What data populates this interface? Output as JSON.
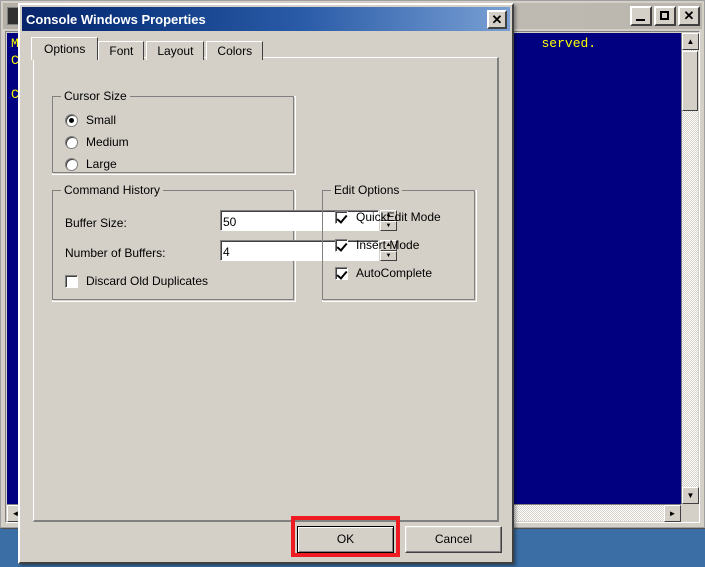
{
  "desktop": {
    "background_color": "#3a6ea5"
  },
  "console_window": {
    "title": "",
    "icon_name": "console-icon",
    "text_color": "#ffff00",
    "background_color": "#000080",
    "lines": [
      "Mi                                                                  served.",
      "Co",
      "",
      "C:"
    ],
    "buttons": {
      "minimize_label": "_",
      "maximize_label": "□",
      "close_label": "✕"
    },
    "scrollbars": {
      "vertical_up": "▲",
      "vertical_down": "▼",
      "horizontal_left": "◄",
      "horizontal_right": "►"
    }
  },
  "dialog": {
    "title": "Console Windows Properties",
    "close_label": "✕",
    "tabs": [
      {
        "label": "Options",
        "selected": true
      },
      {
        "label": "Font",
        "selected": false
      },
      {
        "label": "Layout",
        "selected": false
      },
      {
        "label": "Colors",
        "selected": false
      }
    ],
    "cursor_size": {
      "legend": "Cursor Size",
      "options": [
        {
          "label": "Small",
          "checked": true
        },
        {
          "label": "Medium",
          "checked": false
        },
        {
          "label": "Large",
          "checked": false
        }
      ]
    },
    "command_history": {
      "legend": "Command History",
      "buffer_size": {
        "label": "Buffer Size:",
        "value": "50",
        "spin_up": "▲",
        "spin_down": "▼"
      },
      "number_of_buffers": {
        "label": "Number of Buffers:",
        "value": "4",
        "spin_up": "▲",
        "spin_down": "▼"
      },
      "discard_old_duplicates": {
        "label": "Discard Old Duplicates",
        "checked": false
      }
    },
    "edit_options": {
      "legend": "Edit Options",
      "items": [
        {
          "label": "QuickEdit Mode",
          "checked": true
        },
        {
          "label": "Insert Mode",
          "checked": true
        },
        {
          "label": "AutoComplete",
          "checked": true
        }
      ]
    },
    "footer": {
      "ok_label": "OK",
      "cancel_label": "Cancel"
    }
  },
  "annotation": {
    "highlight_color": "#ee1b23",
    "target": "OK"
  }
}
